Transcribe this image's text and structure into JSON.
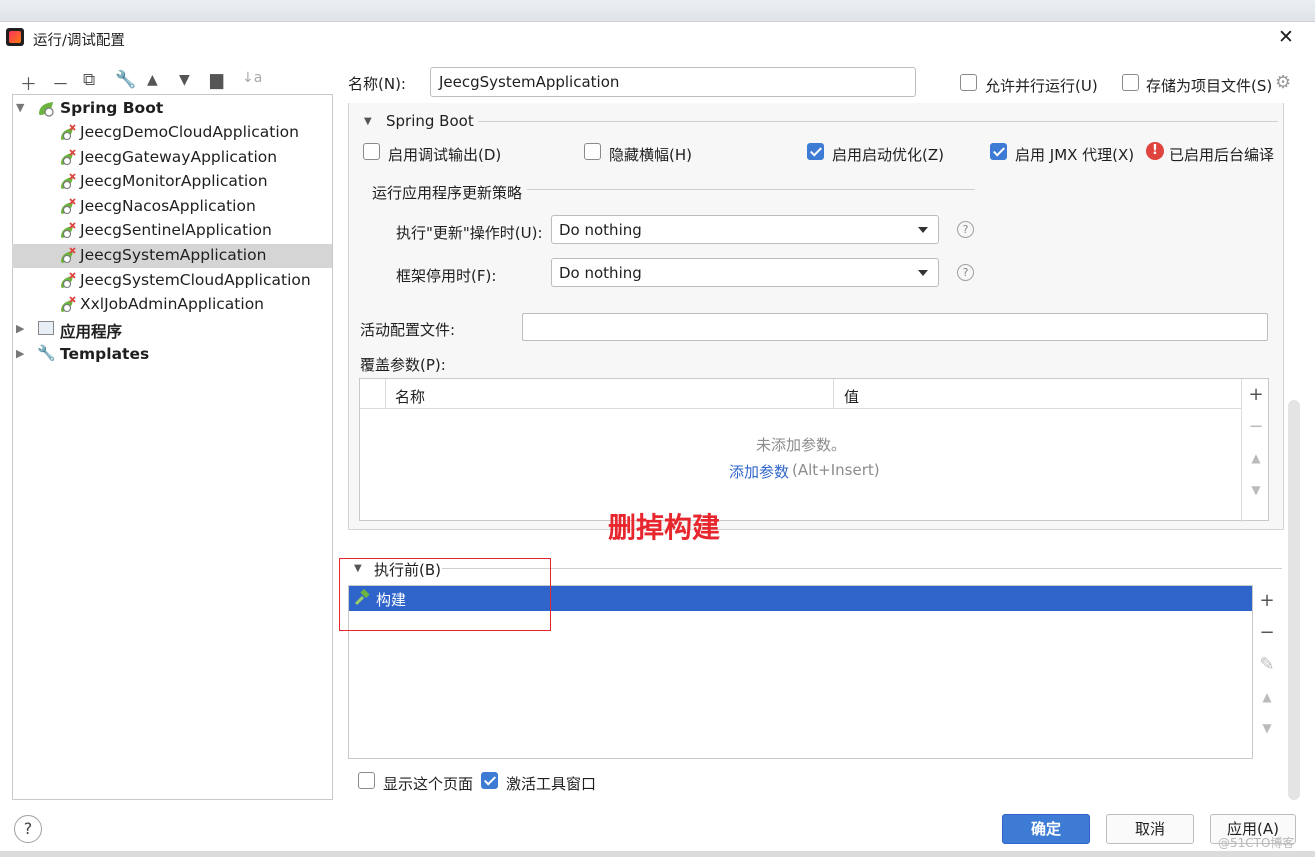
{
  "window": {
    "title": "运行/调试配置"
  },
  "tree": {
    "root": "Spring Boot",
    "items": [
      "JeecgDemoCloudApplication",
      "JeecgGatewayApplication",
      "JeecgMonitorApplication",
      "JeecgNacosApplication",
      "JeecgSentinelApplication",
      "JeecgSystemApplication",
      "JeecgSystemCloudApplication",
      "XxlJobAdminApplication"
    ],
    "selected": "JeecgSystemApplication",
    "app_group": "应用程序",
    "templates": "Templates"
  },
  "form": {
    "name_label": "名称(N):",
    "name_value": "JeecgSystemApplication",
    "allow_parallel": "允许并行运行(U)",
    "store_as_file": "存储为项目文件(S)"
  },
  "spring_boot": {
    "section": "Spring Boot",
    "debug_output": "启用调试输出(D)",
    "hide_banner": "隐藏横幅(H)",
    "launch_opt": "启用启动优化(Z)",
    "jmx": "启用 JMX 代理(X)",
    "bg_compile": "已启用后台编译",
    "policy_section": "运行应用程序更新策略",
    "on_update_label": "执行\"更新\"操作时(U):",
    "on_update_value": "Do nothing",
    "on_frame_label": "框架停用时(F):",
    "on_frame_value": "Do nothing",
    "active_profiles": "活动配置文件:",
    "override_params": "覆盖参数(P):",
    "col_name": "名称",
    "col_value": "值",
    "empty_text": "未添加参数。",
    "add_param": "添加参数",
    "add_shortcut": "(Alt+Insert)"
  },
  "annotation": "删掉构建",
  "before_launch": {
    "section": "执行前(B)",
    "task": "构建"
  },
  "footer": {
    "show_page": "显示这个页面",
    "activate_tool": "激活工具窗口",
    "ok": "确定",
    "cancel": "取消",
    "apply": "应用(A)",
    "watermark": "@51CTO博客"
  },
  "colors": {
    "accent": "#3d7bd4",
    "selection": "#2f65ca",
    "annotation": "#e8262d"
  }
}
